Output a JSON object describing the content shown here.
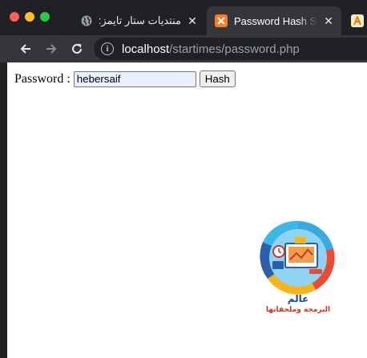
{
  "browser": {
    "tabs": [
      {
        "title": "منتديات ستار تايمز: عالم",
        "icon": "globe-icon",
        "active": false
      },
      {
        "title": "Password Hash Stor",
        "icon": "xampp-icon",
        "active": true
      }
    ],
    "partial_tab_icon": "font-icon",
    "url": {
      "host": "localhost",
      "path": "/startimes/password.php"
    }
  },
  "form": {
    "label": "Password :",
    "password_value": "hebersaif",
    "submit_label": "Hash"
  },
  "watermark": {
    "line1": "عالم",
    "line2": "البرمجة وملحقاتها"
  },
  "colors": {
    "chrome_bg": "#202124",
    "active_tab_bg": "#35363a",
    "autofill_bg": "#e8f0fe",
    "xampp_orange": "#fb7a24"
  }
}
